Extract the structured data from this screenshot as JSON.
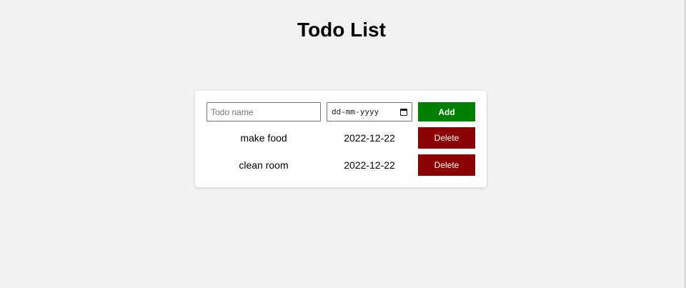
{
  "page": {
    "title": "Todo List"
  },
  "form": {
    "name_placeholder": "Todo name",
    "date_placeholder": "dd-mm-yyyy",
    "add_label": "Add"
  },
  "todos": [
    {
      "name": "make food",
      "date": "2022-12-22",
      "delete_label": "Delete"
    },
    {
      "name": "clean room",
      "date": "2022-12-22",
      "delete_label": "Delete"
    }
  ],
  "colors": {
    "add": "#008000",
    "delete": "#8b0000",
    "background": "#f2f2f2"
  },
  "icons": {
    "date_picker": "calendar-icon"
  }
}
